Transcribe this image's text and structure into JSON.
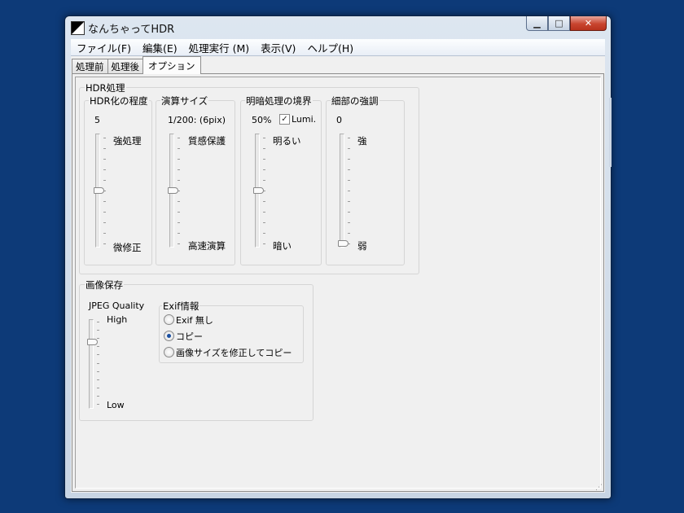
{
  "window": {
    "title": "なんちゃってHDR"
  },
  "menu": [
    "ファイル(F)",
    "編集(E)",
    "処理実行 (M)",
    "表示(V)",
    "ヘルプ(H)"
  ],
  "tabs": [
    "処理前",
    "処理後",
    "オプション"
  ],
  "active_tab": "オプション",
  "hdr": {
    "title": "HDR処理",
    "degree": {
      "title": "HDR化の程度",
      "value": "5",
      "top_label": "強処理",
      "bottom_label": "微修正",
      "level": 0.5
    },
    "size": {
      "title": "演算サイズ",
      "value": "1/200: (6pix)",
      "top_label": "質感保護",
      "bottom_label": "高速演算",
      "level": 0.5
    },
    "boundary": {
      "title": "明暗処理の境界",
      "value": "50%",
      "checkbox_label": "Lumi.",
      "checkbox_checked": true,
      "top_label": "明るい",
      "bottom_label": "暗い",
      "level": 0.5
    },
    "detail": {
      "title": "細部の強調",
      "value": "0",
      "top_label": "強",
      "bottom_label": "弱",
      "level": 0.0
    }
  },
  "save": {
    "title": "画像保存",
    "jpeg": {
      "title": "JPEG Quality",
      "top_label": "High",
      "bottom_label": "Low",
      "level": 0.75
    },
    "exif": {
      "title": "Exif情報",
      "options": [
        "Exif 無し",
        "コピー",
        "画像サイズを修正してコピー"
      ],
      "selected": "コピー"
    }
  }
}
